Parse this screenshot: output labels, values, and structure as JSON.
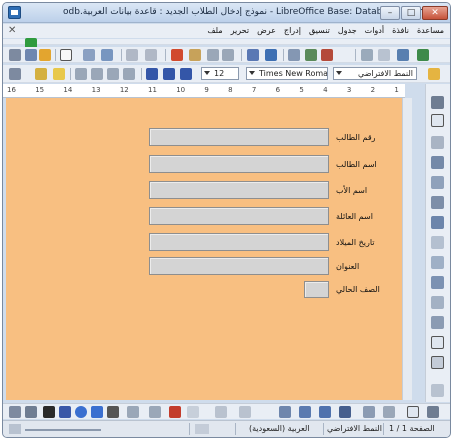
{
  "window": {
    "title": "LibreOffice Base: Database Form - نموذج إدخال الطلاب الجديد : قاعدة بيانات العربية.odb",
    "min_label": "–",
    "max_label": "□",
    "close_label": "✕"
  },
  "menu": {
    "items": [
      "ملف",
      "تحرير",
      "عرض",
      "إدراج",
      "تنسيق",
      "جدول",
      "أدوات",
      "نافذة",
      "مساعدة"
    ],
    "doc_close": "✕"
  },
  "format_toolbar": {
    "font_size": "12",
    "font_name": "Times New Roman",
    "paragraph_style": "النمط الافتراضي"
  },
  "ruler": {
    "marks": [
      "16",
      "15",
      "14",
      "13",
      "12",
      "11",
      "10",
      "9",
      "8",
      "7",
      "6",
      "5",
      "4",
      "3",
      "2",
      "1"
    ]
  },
  "form": {
    "fields": [
      {
        "label": "رقم الطالب"
      },
      {
        "label": "اسم الطالب"
      },
      {
        "label": "اسم الأب"
      },
      {
        "label": "اسم العائلة"
      },
      {
        "label": "تاريخ الميلاد"
      },
      {
        "label": "العنوان"
      },
      {
        "label": "الصف الحالي"
      }
    ]
  },
  "statusbar": {
    "page": "الصفحة 1 / 1",
    "style": "النمط الافتراضي",
    "language": "العربية (السعودية)"
  },
  "colors": {
    "canvas": "#f8bf81",
    "field_fill": "#d4d4d4"
  }
}
